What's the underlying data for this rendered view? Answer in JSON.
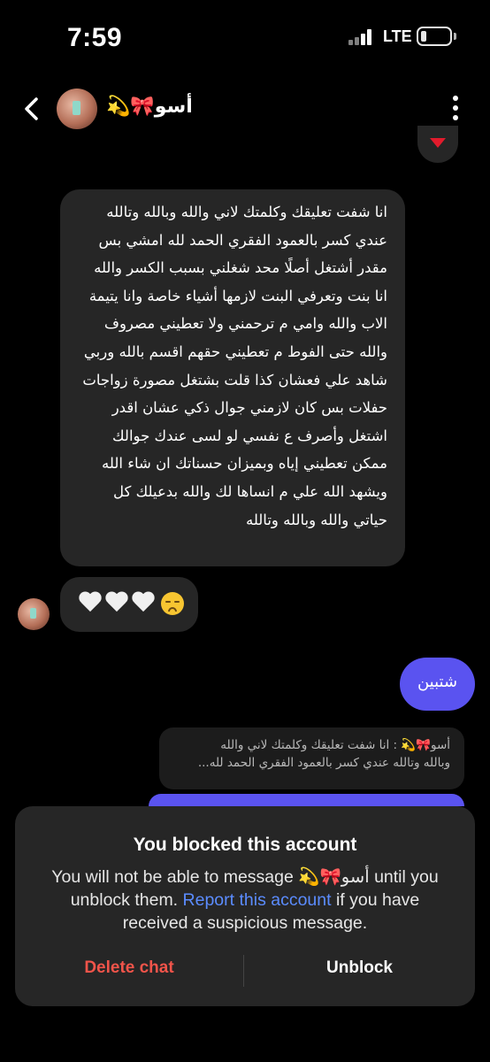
{
  "status_bar": {
    "time": "7:59",
    "network": "LTE"
  },
  "header": {
    "contact_name": "أسو🎀💫",
    "back_icon": "chevron-left-icon",
    "more_icon": "more-vertical-icon"
  },
  "messages": {
    "top_reaction_icon": "red-heart-icon",
    "long_message": "انا شفت تعليقك وكلمتك لاني والله وبالله وتالله عندي كسر بالعمود الفقري الحمد لله امشي بس مقدر أشتغل أصلًا محد شغلني بسبب الكسر والله انا بنت وتعرفي البنت لازمها أشياء خاصة وانا يتيمة الاب والله وامي م ترحمني ولا تعطيني مصروف والله حتى الفوط م تعطيني حقهم اقسم بالله وربي شاهد علي فعشان كذا قلت بشتغل مصورة زواجات حفلات بس كان لازمني جوال ذكي عشان اقدر اشتغل وأصرف ع نفسي لو لسى عندك جوالك ممكن تعطيني إياه وبميزان حسناتك ان شاء الله ويشهد الله علي م انساها لك والله بدعيلك كل حياتي والله وبالله وتالله",
    "emoji_message": "🤍🤍🤍😔",
    "sent_message": "شتبين",
    "reply_preview_line1": "أسو🎀💫 : انا شفت تعليقك وكلمتك لاني والله",
    "reply_preview_line2": "وبالله وتالله عندي كسر بالعمود الفقري الحمد لله..."
  },
  "blocked_panel": {
    "title": "You blocked this account",
    "body_part1": "You will not be able to message",
    "name": "أسو🎀💫",
    "body_part2": "until you unblock them.",
    "report_link": "Report this account",
    "body_part3": "if you have received a suspicious message.",
    "delete_label": "Delete chat",
    "unblock_label": "Unblock"
  },
  "colors": {
    "background": "#000000",
    "received_bubble": "#262626",
    "sent_bubble": "#5a53f0",
    "link": "#5b8cff",
    "destructive": "#f0544a"
  }
}
